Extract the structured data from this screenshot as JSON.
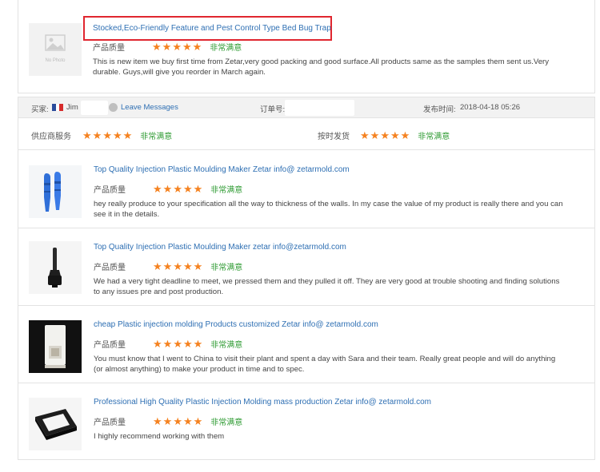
{
  "top_review": {
    "product_title": "Stocked,Eco-Friendly Feature and Pest Control Type Bed Bug Trap",
    "thumb_text": "No Photo",
    "quality_label": "产品质量",
    "satisfaction": "非常满意",
    "stars": 5,
    "text": "This is new item we buy first time from Zetar,very good packing and good surface.All products same as the samples them sent us.Very durable. Guys,will give you reorder in March again."
  },
  "order": {
    "buyer_label": "买家:",
    "buyer_name": "Jim",
    "leave_messages": "Leave Messages",
    "order_no_label": "订单号:",
    "publish_time_label": "发布时间:",
    "publish_time": "2018-04-18 05:26",
    "flag_colors": [
      "#2b4c9b",
      "#ffffff",
      "#d62b2b"
    ]
  },
  "service": {
    "supplier_label": "供应商服务",
    "supplier_stars": 5,
    "supplier_satisfaction": "非常满意",
    "delivery_label": "按时发货",
    "delivery_stars": 5,
    "delivery_satisfaction": "非常满意"
  },
  "items": [
    {
      "title": "Top Quality Injection Plastic Moulding Maker Zetar info@ zetarmold.com",
      "quality_label": "产品质量",
      "stars": 5,
      "satisfaction": "非常满意",
      "text": "hey really produce to your specification all the way to thickness of the walls. In my case the value of my product is really there and you can see it in the details.",
      "thumb_icon": "blue-plastic-parts-icon"
    },
    {
      "title": "Top Quality Injection Plastic Moulding Maker zetar info@zetarmold.com",
      "quality_label": "产品质量",
      "stars": 5,
      "satisfaction": "非常满意",
      "text": "We had a very tight deadline to meet, we pressed them and they pulled it off. They are very good at trouble shooting and finding solutions to any issues pre and post production.",
      "thumb_icon": "black-plastic-plug-icon"
    },
    {
      "title": "cheap Plastic injection molding Products customized Zetar info@ zetarmold.com",
      "quality_label": "产品质量",
      "stars": 5,
      "satisfaction": "非常满意",
      "text": "You must know that I went to China to visit their plant and spent a day with Sara and their team. Really great people and will do anything (or almost anything) to make your product in time and to spec.",
      "thumb_icon": "white-plastic-part-icon"
    },
    {
      "title": "Professional High Quality Plastic Injection Molding mass production Zetar info@ zetarmold.com",
      "quality_label": "产品质量",
      "stars": 5,
      "satisfaction": "非常满意",
      "text": "I highly recommend working with them",
      "thumb_icon": "black-plastic-frame-icon"
    }
  ],
  "colors": {
    "link": "#2e6fb3",
    "star": "#f58220",
    "satisfied": "#2f9b33",
    "highlight_box": "#e0262f"
  }
}
